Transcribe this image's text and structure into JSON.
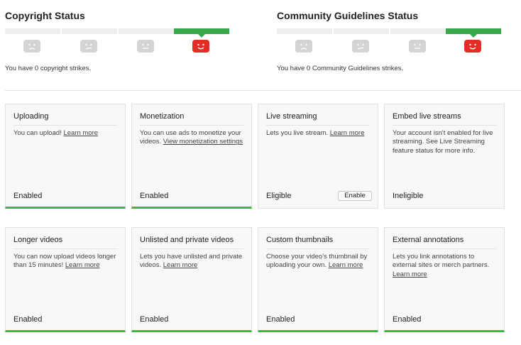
{
  "copyright": {
    "title": "Copyright Status",
    "strikes_text": "You have 0 copyright strikes.",
    "active_segment": 4
  },
  "community": {
    "title": "Community Guidelines Status",
    "strikes_text": "You have 0 Community Guidelines strikes.",
    "active_segment": 4
  },
  "colors": {
    "meter_active": "#38a84a",
    "meter_inactive": "#eeeeee",
    "face_inactive": "#d4d4d4",
    "face_active": "#e52d27",
    "enabled_bar": "#3cbc3c"
  },
  "icons": [
    "sad-face-icon",
    "skeptical-face-icon",
    "neutral-face-icon",
    "happy-face-icon"
  ],
  "features": [
    {
      "title": "Uploading",
      "desc": "You can upload!",
      "link": "Learn more",
      "status": "Enabled"
    },
    {
      "title": "Monetization",
      "desc": "You can use ads to monetize your videos.",
      "link": "View monetization settings",
      "status": "Enabled"
    },
    {
      "title": "Live streaming",
      "desc": "Lets you live stream.",
      "link": "Learn more",
      "status": "Eligible",
      "button": "Enable"
    },
    {
      "title": "Embed live streams",
      "desc": "Your account isn't enabled for live streaming. See Live Streaming feature status for more info.",
      "link": "",
      "status": "Ineligible"
    },
    {
      "title": "Longer videos",
      "desc": "You can now upload videos longer than 15 minutes!",
      "link": "Learn more",
      "status": "Enabled"
    },
    {
      "title": "Unlisted and private videos",
      "desc": "Lets you have unlisted and private videos.",
      "link": "Learn more",
      "status": "Enabled"
    },
    {
      "title": "Custom thumbnails",
      "desc": "Choose your video's thumbnail by uploading your own.",
      "link": "Learn more",
      "status": "Enabled"
    },
    {
      "title": "External annotations",
      "desc": "Lets you link annotations to external sites or merch partners.",
      "link": "Learn more",
      "status": "Enabled"
    }
  ]
}
